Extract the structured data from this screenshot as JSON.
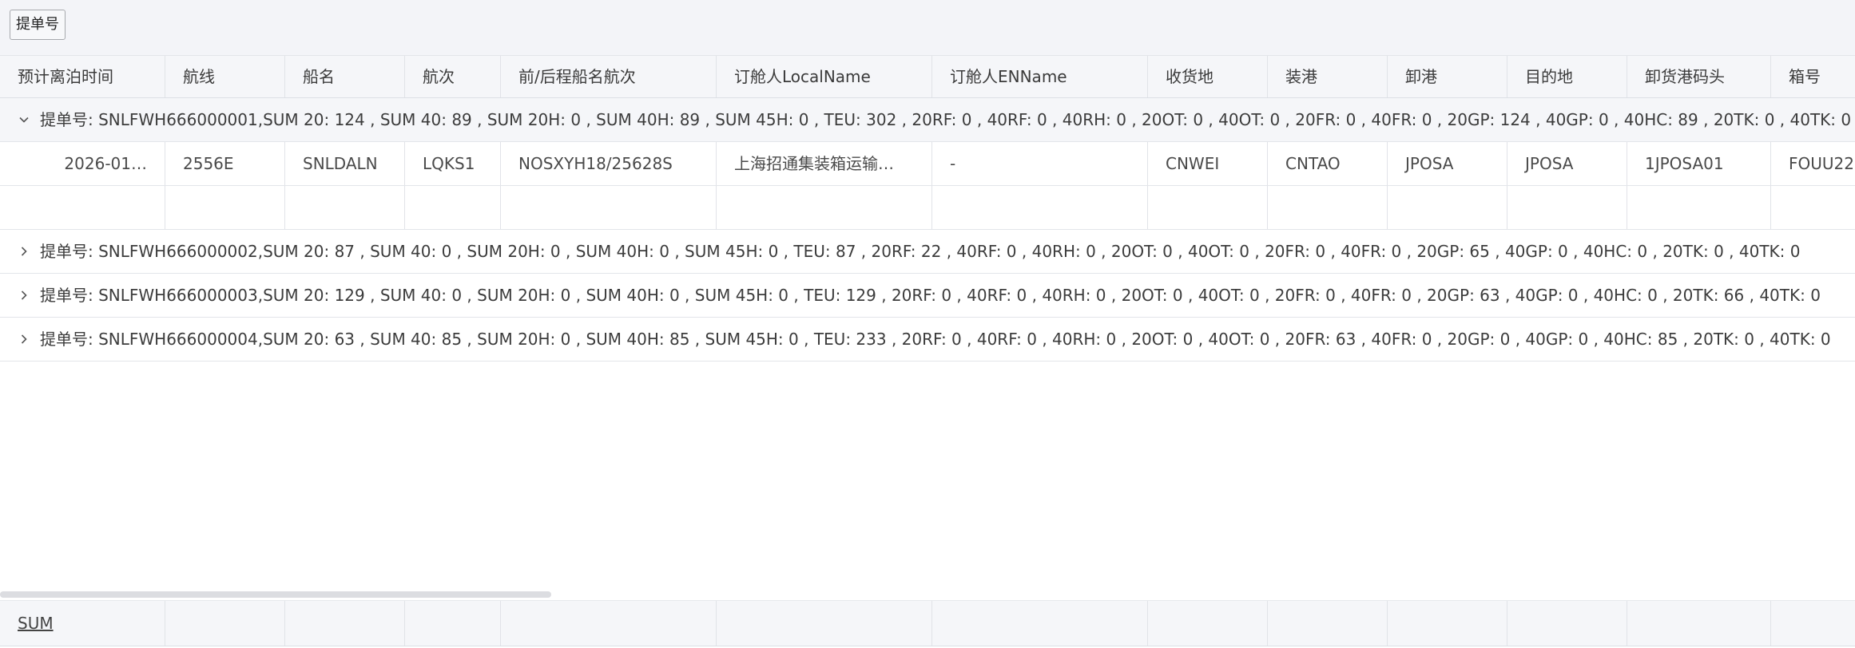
{
  "toolbar": {
    "group_button_label": "提单号"
  },
  "columns": [
    "预计离泊时间",
    "航线",
    "船名",
    "航次",
    "前/后程船名航次",
    "订舱人LocalName",
    "订舱人ENName",
    "收货地",
    "装港",
    "卸港",
    "目的地",
    "卸货港码头",
    "箱号"
  ],
  "groups": [
    {
      "text": "提单号: SNLFWH666000001,SUM 20: 124 , SUM 40: 89 , SUM 20H: 0 , SUM 40H: 89 , SUM 45H: 0 , TEU: 302 , 20RF: 0 , 40RF: 0 , 40RH: 0 , 20OT: 0 , 40OT: 0 , 20FR: 0 , 40FR: 0 , 20GP: 124 , 40GP: 0 , 40HC: 89 , 20TK: 0 , 40TK: 0",
      "expanded": true
    },
    {
      "text": "提单号: SNLFWH666000002,SUM 20: 87 , SUM 40: 0 , SUM 20H: 0 , SUM 40H: 0 , SUM 45H: 0 , TEU: 87 , 20RF: 22 , 40RF: 0 , 40RH: 0 , 20OT: 0 , 40OT: 0 , 20FR: 0 , 40FR: 0 , 20GP: 65 , 40GP: 0 , 40HC: 0 , 20TK: 0 , 40TK: 0",
      "expanded": false
    },
    {
      "text": "提单号: SNLFWH666000003,SUM 20: 129 , SUM 40: 0 , SUM 20H: 0 , SUM 40H: 0 , SUM 45H: 0 , TEU: 129 , 20RF: 0 , 40RF: 0 , 40RH: 0 , 20OT: 0 , 40OT: 0 , 20FR: 0 , 40FR: 0 , 20GP: 63 , 40GP: 0 , 40HC: 0 , 20TK: 66 , 40TK: 0",
      "expanded": false
    },
    {
      "text": "提单号: SNLFWH666000004,SUM 20: 63 , SUM 40: 85 , SUM 20H: 0 , SUM 40H: 85 , SUM 45H: 0 , TEU: 233 , 20RF: 0 , 40RF: 0 , 40RH: 0 , 20OT: 0 , 40OT: 0 , 20FR: 63 , 40FR: 0 , 20GP: 0 , 40GP: 0 , 40HC: 85 , 20TK: 0 , 40TK: 0",
      "expanded": false
    }
  ],
  "rows": [
    [
      "2026-01…",
      "2556E",
      "SNLDALN",
      "LQKS1",
      "NOSXYH18/25628S",
      "上海招通集装箱运输…",
      "-",
      "CNWEI",
      "CNTAO",
      "JPOSA",
      "JPOSA",
      "1JPOSA01",
      "FOUU22"
    ],
    [
      "",
      "",
      "",
      "",
      "",
      "",
      "",
      "",
      "",
      "",
      "",
      "",
      ""
    ]
  ],
  "footer": {
    "sum_label": "SUM"
  },
  "icons": {
    "expanded": "chevron-down-icon",
    "collapsed": "chevron-right-icon"
  }
}
